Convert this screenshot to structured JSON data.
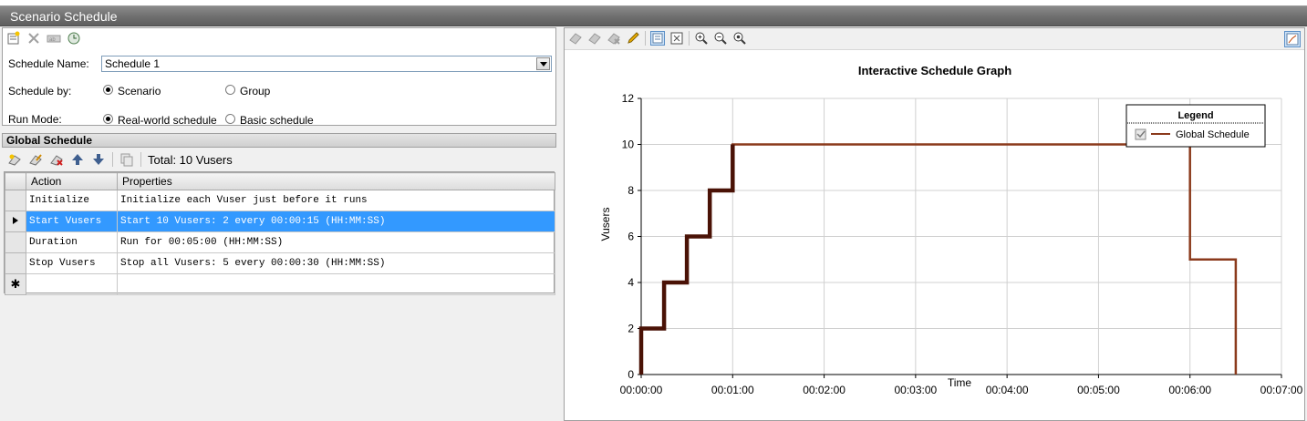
{
  "window": {
    "title": "Scenario Schedule"
  },
  "settings": {
    "schedule_name_label": "Schedule Name:",
    "schedule_name_value": "Schedule 1",
    "schedule_by_label": "Schedule by:",
    "schedule_by_options": [
      "Scenario",
      "Group"
    ],
    "schedule_by_selected": "Scenario",
    "run_mode_label": "Run Mode:",
    "run_mode_options": [
      "Real-world schedule",
      "Basic schedule"
    ],
    "run_mode_selected": "Real-world schedule"
  },
  "global_schedule": {
    "header": "Global Schedule",
    "total_label": "Total: 10 Vusers",
    "columns": [
      "Action",
      "Properties"
    ],
    "rows": [
      {
        "action": "Initialize",
        "properties": "Initialize each Vuser just before it runs"
      },
      {
        "action": "Start  Vusers",
        "properties": "Start 10 Vusers: 2 every 00:00:15 (HH:MM:SS)"
      },
      {
        "action": "Duration",
        "properties": "Run for 00:05:00 (HH:MM:SS)"
      },
      {
        "action": "Stop Vusers",
        "properties": "Stop all Vusers: 5 every 00:00:30 (HH:MM:SS)"
      }
    ],
    "selected_row": 1,
    "new_row_marker": "✱"
  },
  "chart_data": {
    "type": "line",
    "title": "Interactive Schedule Graph",
    "xlabel": "Time",
    "ylabel": "Vusers",
    "x_ticks": [
      "00:00:00",
      "00:01:00",
      "00:02:00",
      "00:03:00",
      "00:04:00",
      "00:05:00",
      "00:06:00",
      "00:07:00"
    ],
    "xlim_seconds": [
      0,
      420
    ],
    "ylim": [
      0,
      12
    ],
    "y_ticks": [
      0,
      2,
      4,
      6,
      8,
      10,
      12
    ],
    "grid": true,
    "legend_title": "Legend",
    "legend_position": "top-right",
    "series": [
      {
        "name": "Global Schedule",
        "color": "#8b3a1c",
        "points_seconds": [
          [
            0,
            0
          ],
          [
            0,
            2
          ],
          [
            15,
            2
          ],
          [
            15,
            4
          ],
          [
            30,
            4
          ],
          [
            30,
            6
          ],
          [
            45,
            6
          ],
          [
            45,
            8
          ],
          [
            60,
            8
          ],
          [
            60,
            10
          ],
          [
            360,
            10
          ],
          [
            360,
            5
          ],
          [
            390,
            5
          ],
          [
            390,
            0
          ]
        ]
      }
    ],
    "ramp_highlight_color": "#4a1206"
  },
  "colors": {
    "selection": "#3399ff",
    "titlebar": "#6e6e6e",
    "line": "#8b3a1c"
  }
}
